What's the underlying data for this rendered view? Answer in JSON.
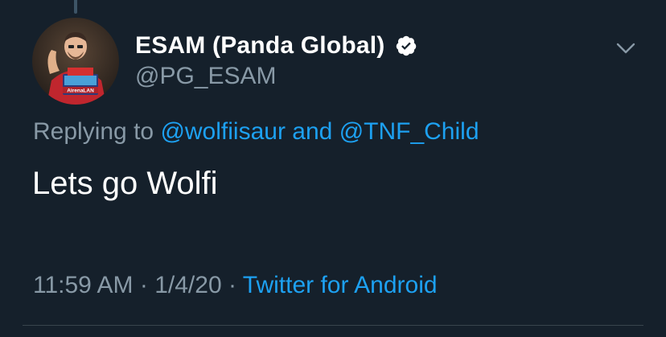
{
  "tweet": {
    "display_name": "ESAM (Panda Global)",
    "handle": "@PG_ESAM",
    "verified": true,
    "reply_prefix": "Replying to",
    "reply_mention_1": "@wolfiisaur",
    "reply_and": "and",
    "reply_mention_2": "@TNF_Child",
    "text": "Lets go Wolfi",
    "time": "11:59 AM",
    "separator": "·",
    "date": "1/4/20",
    "source": "Twitter for Android"
  },
  "avatar": {
    "banner_text": "AirenaLAN"
  },
  "colors": {
    "background": "#15202b",
    "primary_text": "#ffffff",
    "secondary_text": "#8899a6",
    "link": "#1da1f2",
    "divider": "#38444d"
  },
  "icons": {
    "verified": "verified-badge-icon",
    "menu": "chevron-down-icon"
  }
}
